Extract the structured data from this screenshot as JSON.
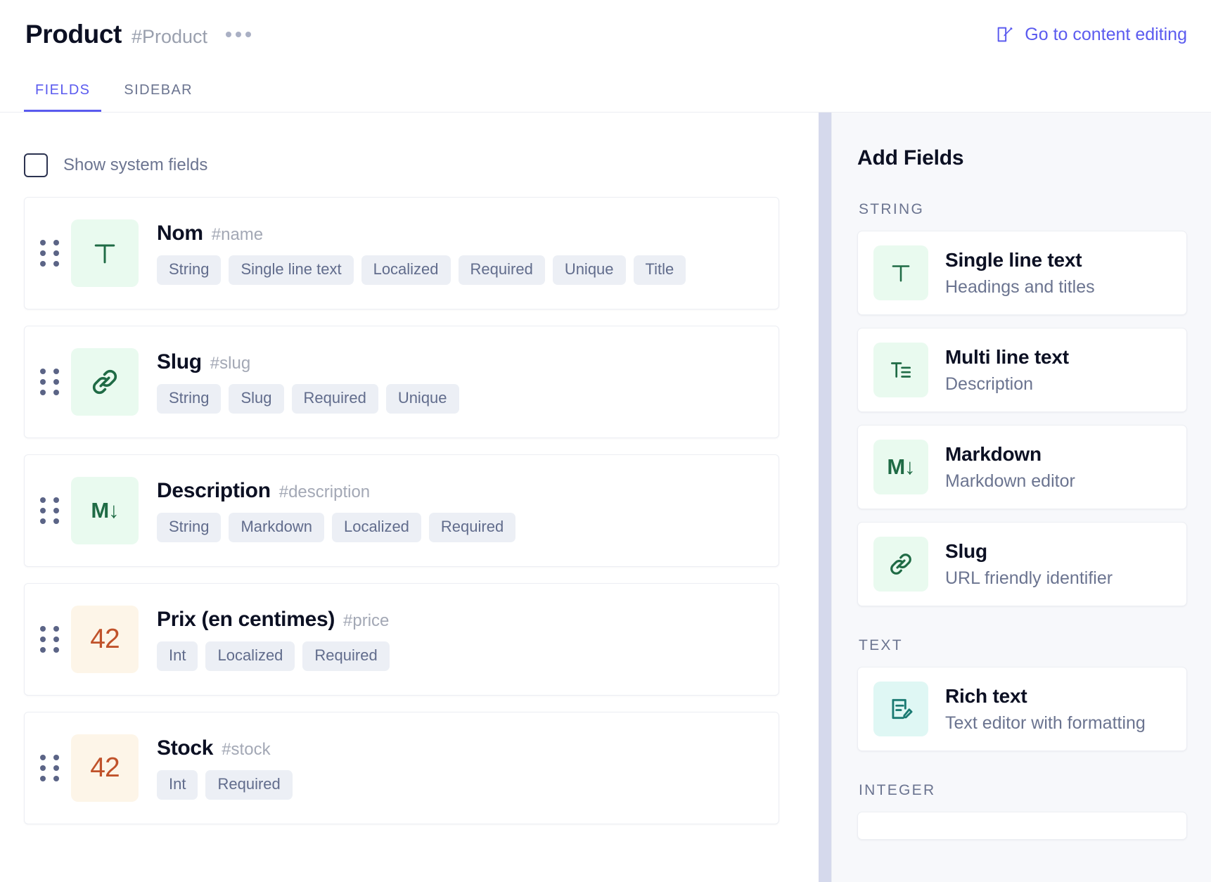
{
  "header": {
    "title": "Product",
    "slug": "#Product",
    "overflow_menu": "•••",
    "content_editing_link": "Go to content editing",
    "edit_icon": "pencil-square-icon",
    "accent_color": "#5b5bef"
  },
  "tabs": [
    {
      "label": "FIELDS",
      "active": true
    },
    {
      "label": "SIDEBAR",
      "active": false
    }
  ],
  "toolbar": {
    "show_system_fields_label": "Show system fields",
    "show_system_fields_checked": false
  },
  "fields": [
    {
      "name": "Nom",
      "key": "#name",
      "icon": "single-line-text-icon",
      "icon_glyph": "T",
      "icon_style": "green",
      "tags": [
        "String",
        "Single line text",
        "Localized",
        "Required",
        "Unique",
        "Title"
      ]
    },
    {
      "name": "Slug",
      "key": "#slug",
      "icon": "link-icon",
      "icon_glyph": "",
      "icon_style": "green",
      "tags": [
        "String",
        "Slug",
        "Required",
        "Unique"
      ]
    },
    {
      "name": "Description",
      "key": "#description",
      "icon": "markdown-icon",
      "icon_glyph": "M↓",
      "icon_style": "green",
      "tags": [
        "String",
        "Markdown",
        "Localized",
        "Required"
      ]
    },
    {
      "name": "Prix (en centimes)",
      "key": "#price",
      "icon": "integer-icon",
      "icon_glyph": "42",
      "icon_style": "cream",
      "tags": [
        "Int",
        "Localized",
        "Required"
      ]
    },
    {
      "name": "Stock",
      "key": "#stock",
      "icon": "integer-icon",
      "icon_glyph": "42",
      "icon_style": "cream",
      "tags": [
        "Int",
        "Required"
      ]
    }
  ],
  "panel": {
    "title": "Add Fields",
    "groups": [
      {
        "label": "STRING",
        "items": [
          {
            "name": "Single line text",
            "desc": "Headings and titles",
            "icon": "single-line-text-icon",
            "icon_style": "green"
          },
          {
            "name": "Multi line text",
            "desc": "Description",
            "icon": "multi-line-text-icon",
            "icon_style": "green"
          },
          {
            "name": "Markdown",
            "desc": "Markdown editor",
            "icon": "markdown-icon",
            "icon_style": "green"
          },
          {
            "name": "Slug",
            "desc": "URL friendly identifier",
            "icon": "link-icon",
            "icon_style": "green"
          }
        ]
      },
      {
        "label": "TEXT",
        "items": [
          {
            "name": "Rich text",
            "desc": "Text editor with formatting",
            "icon": "rich-text-icon",
            "icon_style": "teal"
          }
        ]
      },
      {
        "label": "INTEGER",
        "items": []
      }
    ]
  },
  "colors": {
    "accent": "#5b5bef",
    "icon_green_bg": "#e9faef",
    "icon_green_fg": "#1f6b45",
    "icon_cream_bg": "#fdf5e8",
    "icon_cream_fg": "#c0522a",
    "icon_teal_bg": "#dff7f4",
    "icon_teal_fg": "#1a7a72",
    "tag_bg": "#eceff5",
    "tag_fg": "#616c8c",
    "divider": "#d5d9ec",
    "panel_bg": "#f7f8fb"
  }
}
